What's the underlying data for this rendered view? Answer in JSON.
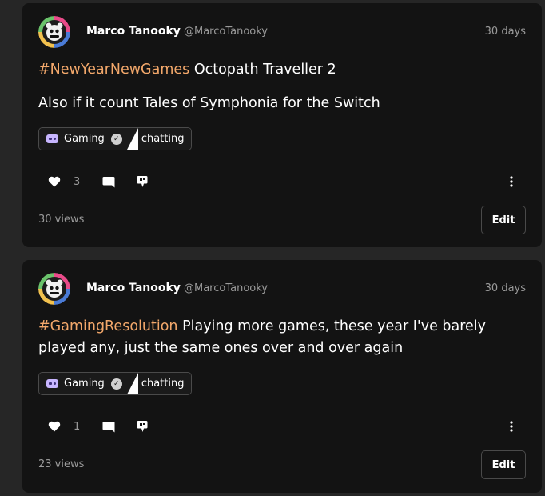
{
  "posts": [
    {
      "author": "Marco Tanooky",
      "handle": "@MarcoTanooky",
      "time": "30 days",
      "hashtag": "#NewYearNewGames",
      "text": " Octopath Traveller 2",
      "text2": "Also if it count Tales of Symphonia for the Switch",
      "community": "Gaming",
      "channel": "chatting",
      "likes": "3",
      "views": "30 views",
      "edit_label": "Edit"
    },
    {
      "author": "Marco Tanooky",
      "handle": "@MarcoTanooky",
      "time": "30 days",
      "hashtag": "#GamingResolution",
      "text": " Playing more games, these year I've barely played any, just the same ones over and over again",
      "community": "Gaming",
      "channel": "chatting",
      "likes": "1",
      "views": "23 views",
      "edit_label": "Edit"
    }
  ],
  "icons": {
    "like": "heart-icon",
    "comment": "comment-icon",
    "share": "share-hand-icon",
    "more": "kebab-menu-icon",
    "community": "gamepad-icon",
    "verified": "verified-badge-icon"
  },
  "colors": {
    "background": "#262626",
    "card": "#131313",
    "hashtag": "#f3a86b",
    "muted": "#9a9a9a"
  }
}
